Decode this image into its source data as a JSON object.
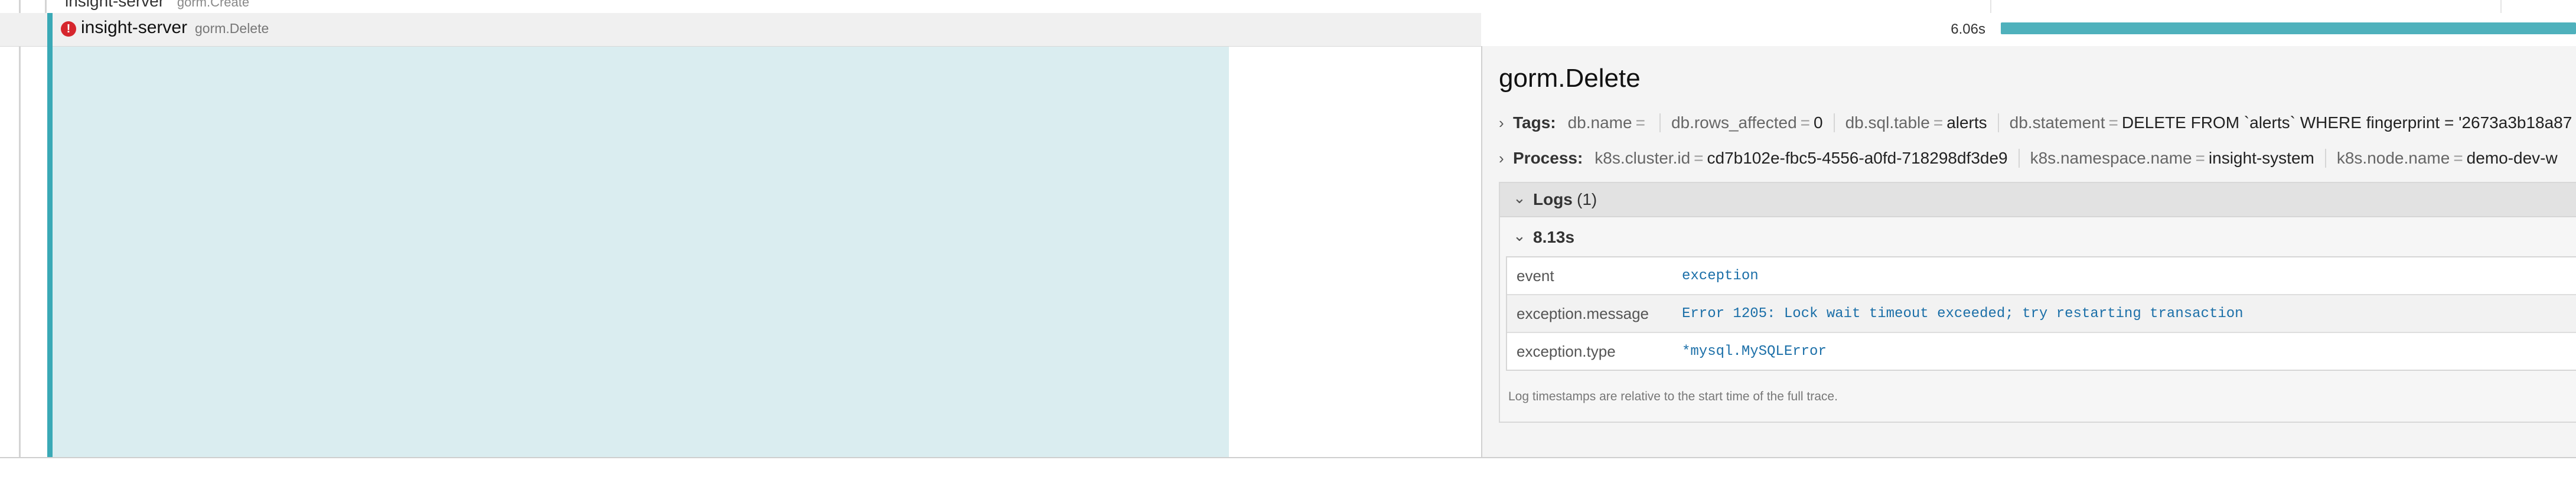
{
  "previous_row": {
    "service": "insight-server",
    "operation": "gorm.Create",
    "timeline_tick": "5 columns"
  },
  "selected_row": {
    "service": "insight-server",
    "operation": "gorm.Delete",
    "error_icon": "error-icon",
    "duration": "6.06s"
  },
  "detail": {
    "title": "gorm.Delete",
    "tags": {
      "label": "Tags:",
      "items": [
        {
          "key": "db.name",
          "value": ""
        },
        {
          "key": "db.rows_affected",
          "value": "0"
        },
        {
          "key": "db.sql.table",
          "value": "alerts"
        },
        {
          "key": "db.statement",
          "value": "DELETE FROM `alerts` WHERE fingerprint = '2673a3b18a87"
        }
      ]
    },
    "process": {
      "label": "Process:",
      "items": [
        {
          "key": "k8s.cluster.id",
          "value": "cd7b102e-fbc5-4556-a0fd-718298df3de9"
        },
        {
          "key": "k8s.namespace.name",
          "value": "insight-system"
        },
        {
          "key": "k8s.node.name",
          "value": "demo-dev-w"
        }
      ]
    },
    "logs": {
      "label": "Logs",
      "count": "(1)",
      "entries": [
        {
          "timestamp": "8.13s",
          "fields": [
            {
              "key": "event",
              "value": "exception"
            },
            {
              "key": "exception.message",
              "value": "Error 1205: Lock wait timeout exceeded; try restarting transaction"
            },
            {
              "key": "exception.type",
              "value": "*mysql.MySQLError"
            }
          ]
        }
      ],
      "footnote": "Log timestamps are relative to the start time of the full trace."
    }
  },
  "colors": {
    "accent": "#3aa9b6",
    "error": "#d6262d",
    "detail_bg": "#daedf0"
  }
}
